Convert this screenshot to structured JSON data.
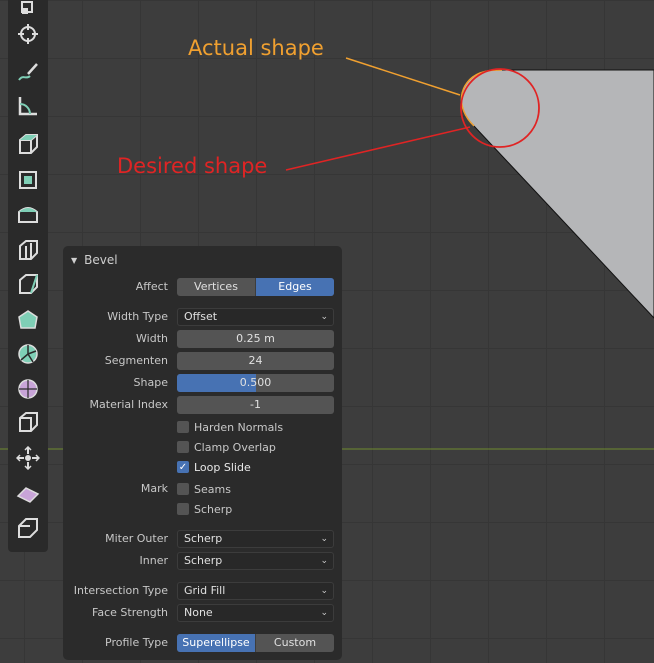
{
  "annotations": {
    "actual_shape": "Actual shape",
    "desired_shape": "Desired shape",
    "actual_color": "#f0a030",
    "desired_color": "#e02424"
  },
  "viewport": {
    "mesh_color": "#b5b6b8",
    "axis_line_color": "#6e8a2e"
  },
  "toolbar": {
    "tools": [
      "transform-icon",
      "cursor-icon",
      "annotate-icon",
      "measure-icon",
      "add-cube-icon",
      "extrude-region-icon",
      "extrude-manifold-icon",
      "inset-faces-icon",
      "bevel-icon",
      "loop-cut-icon",
      "knife-icon",
      "poly-build-icon",
      "spin-icon",
      "smooth-icon",
      "edge-slide-icon",
      "shrink-fatten-icon",
      "shear-icon",
      "rip-region-icon"
    ]
  },
  "bevel_panel": {
    "title": "Bevel",
    "affect_label": "Affect",
    "affect_options": [
      "Vertices",
      "Edges"
    ],
    "affect_selected": "Edges",
    "width_type_label": "Width Type",
    "width_type_value": "Offset",
    "width_label": "Width",
    "width_value": "0.25 m",
    "segments_label": "Segmenten",
    "segments_value": "24",
    "shape_label": "Shape",
    "shape_value": "0.500",
    "shape_fraction": 0.5,
    "material_index_label": "Material Index",
    "material_index_value": "-1",
    "harden_normals_label": "Harden Normals",
    "harden_normals_checked": false,
    "clamp_overlap_label": "Clamp Overlap",
    "clamp_overlap_checked": false,
    "loop_slide_label": "Loop Slide",
    "loop_slide_checked": true,
    "mark_label": "Mark",
    "seams_label": "Seams",
    "seams_checked": false,
    "sharp_label": "Scherp",
    "sharp_checked": false,
    "miter_outer_label": "Miter Outer",
    "miter_outer_value": "Scherp",
    "inner_label": "Inner",
    "inner_value": "Scherp",
    "intersection_type_label": "Intersection Type",
    "intersection_type_value": "Grid Fill",
    "face_strength_label": "Face Strength",
    "face_strength_value": "None",
    "profile_type_label": "Profile Type",
    "profile_type_options": [
      "Superellipse",
      "Custom"
    ],
    "profile_type_selected": "Superellipse",
    "accent_color": "#4772b3"
  }
}
